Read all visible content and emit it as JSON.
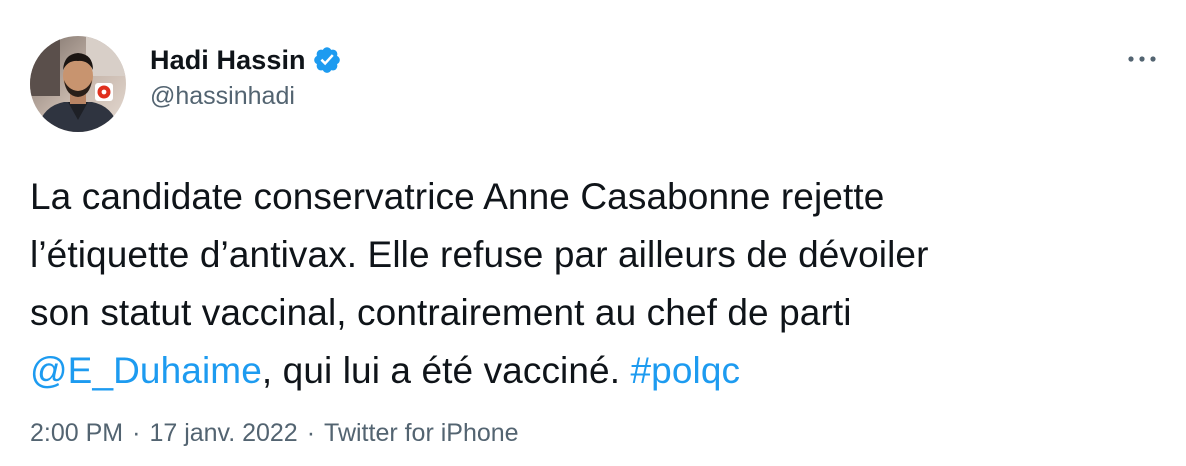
{
  "author": {
    "display_name": "Hadi Hassin",
    "handle": "@hassinhadi",
    "verified": true
  },
  "tweet": {
    "text_1": "La candidate conservatrice Anne Casabonne rejette\nl’étiquette d’antivax. Elle refuse par ailleurs de dévoiler\nson statut vaccinal, contrairement au chef de parti\n",
    "mention": "@E_Duhaime",
    "text_2": ", qui lui a été vacciné. ",
    "hashtag": "#polqc"
  },
  "meta": {
    "time": "2:00 PM",
    "separator_1": "·",
    "date": "17 janv. 2022",
    "separator_2": "·",
    "source": "Twitter for iPhone"
  },
  "icons": {
    "verified": "verified-badge-icon",
    "more": "more-horizontal-icon"
  },
  "colors": {
    "link": "#1d9bf0",
    "secondary_text": "#536471",
    "primary_text": "#0f1419",
    "verified": "#1d9bf0"
  }
}
